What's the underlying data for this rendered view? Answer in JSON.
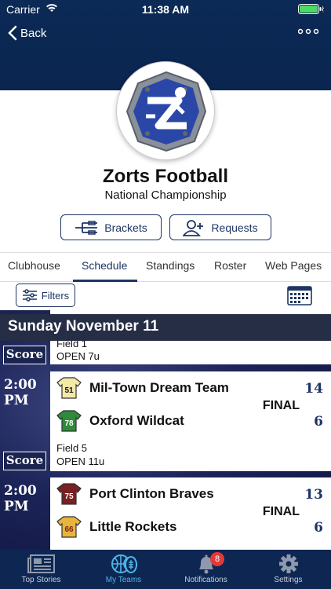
{
  "status_bar": {
    "carrier": "Carrier",
    "time": "11:38 AM"
  },
  "nav": {
    "back_label": "Back"
  },
  "team": {
    "name": "Zorts Football",
    "subtitle": "National Championship"
  },
  "actions": {
    "brackets_label": "Brackets",
    "requests_label": "Requests"
  },
  "tabs": [
    {
      "label": "Clubhouse"
    },
    {
      "label": "Schedule"
    },
    {
      "label": "Standings"
    },
    {
      "label": "Roster"
    },
    {
      "label": "Web Pages"
    }
  ],
  "active_tab": "Schedule",
  "filters": {
    "label": "Filters"
  },
  "schedule": {
    "day": "Sunday November 11",
    "games": [
      {
        "score_label": "Score",
        "field": "Field 1",
        "division": "OPEN 7u"
      },
      {
        "time": "2:00",
        "ampm": "PM",
        "home": {
          "name": "Mil-Town Dream Team",
          "jersey": "51",
          "color": "#f3e8a6",
          "score": "14"
        },
        "away": {
          "name": "Oxford Wildcat",
          "jersey": "78",
          "color": "#2e8b3a",
          "score": "6"
        },
        "status": "FINAL",
        "score_label": "Score",
        "field": "Field 5",
        "division": "OPEN 11u"
      },
      {
        "time": "2:00",
        "ampm": "PM",
        "home": {
          "name": "Port Clinton Braves",
          "jersey": "75",
          "color": "#7a1f22",
          "score": "13"
        },
        "away": {
          "name": "Little Rockets",
          "jersey": "66",
          "color": "#e8b43c",
          "score": "6"
        },
        "status": "FINAL"
      }
    ]
  },
  "tabbar": [
    {
      "label": "Top Stories",
      "icon": "newspaper-icon"
    },
    {
      "label": "My Teams",
      "icon": "sports-balls-icon"
    },
    {
      "label": "Notifications",
      "icon": "bell-icon",
      "badge": "8"
    },
    {
      "label": "Settings",
      "icon": "gear-icon"
    }
  ],
  "colors": {
    "navy": "#0b2a55",
    "accent": "#1e3564",
    "active_tab": "#4fb6e8",
    "badge": "#e53935"
  }
}
